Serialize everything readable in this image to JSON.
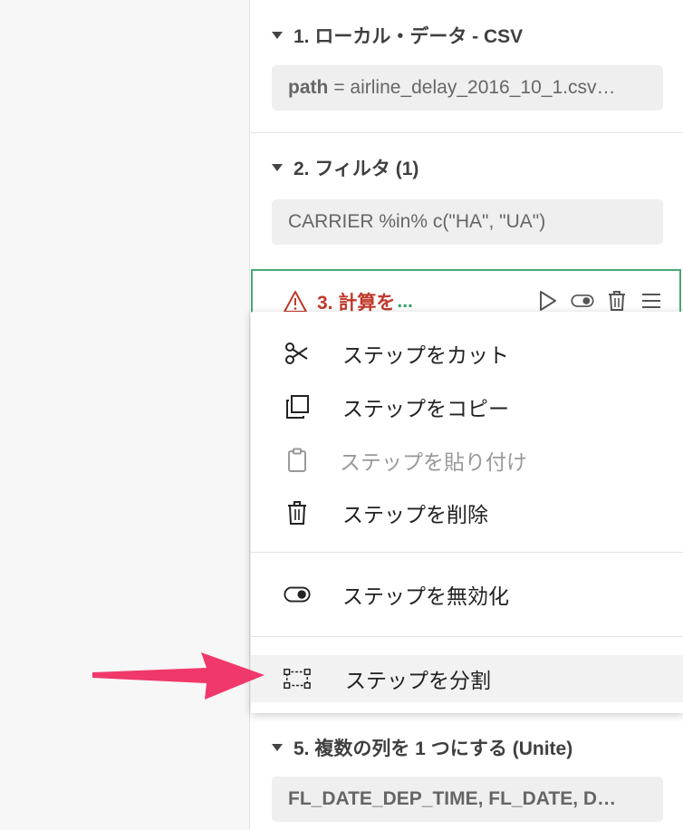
{
  "steps": [
    {
      "title": "1. ローカル・データ - CSV",
      "chip_key": "path",
      "chip_text": "= airline_delay_2016_10_1.csv…"
    },
    {
      "title": "2. フィルタ (1)",
      "chip_text": "CARRIER %in% c(\"HA\", \"UA\")"
    },
    {
      "title": "3. 計算を",
      "title_suffix": "..."
    },
    {
      "title": "5. 複数の列を 1 つにする (Unite)",
      "chip_text": "FL_DATE_DEP_TIME, FL_DATE, D…"
    }
  ],
  "step_tools": [
    "play-icon",
    "toggle-icon",
    "trash-icon",
    "menu-icon"
  ],
  "context_menu": {
    "cut": "ステップをカット",
    "copy": "ステップをコピー",
    "paste": "ステップを貼り付け",
    "delete": "ステップを削除",
    "disable": "ステップを無効化",
    "split": "ステップを分割"
  },
  "colors": {
    "accent_green": "#4aa872",
    "error_red": "#c0392b",
    "arrow_pink": "#f0386b"
  }
}
